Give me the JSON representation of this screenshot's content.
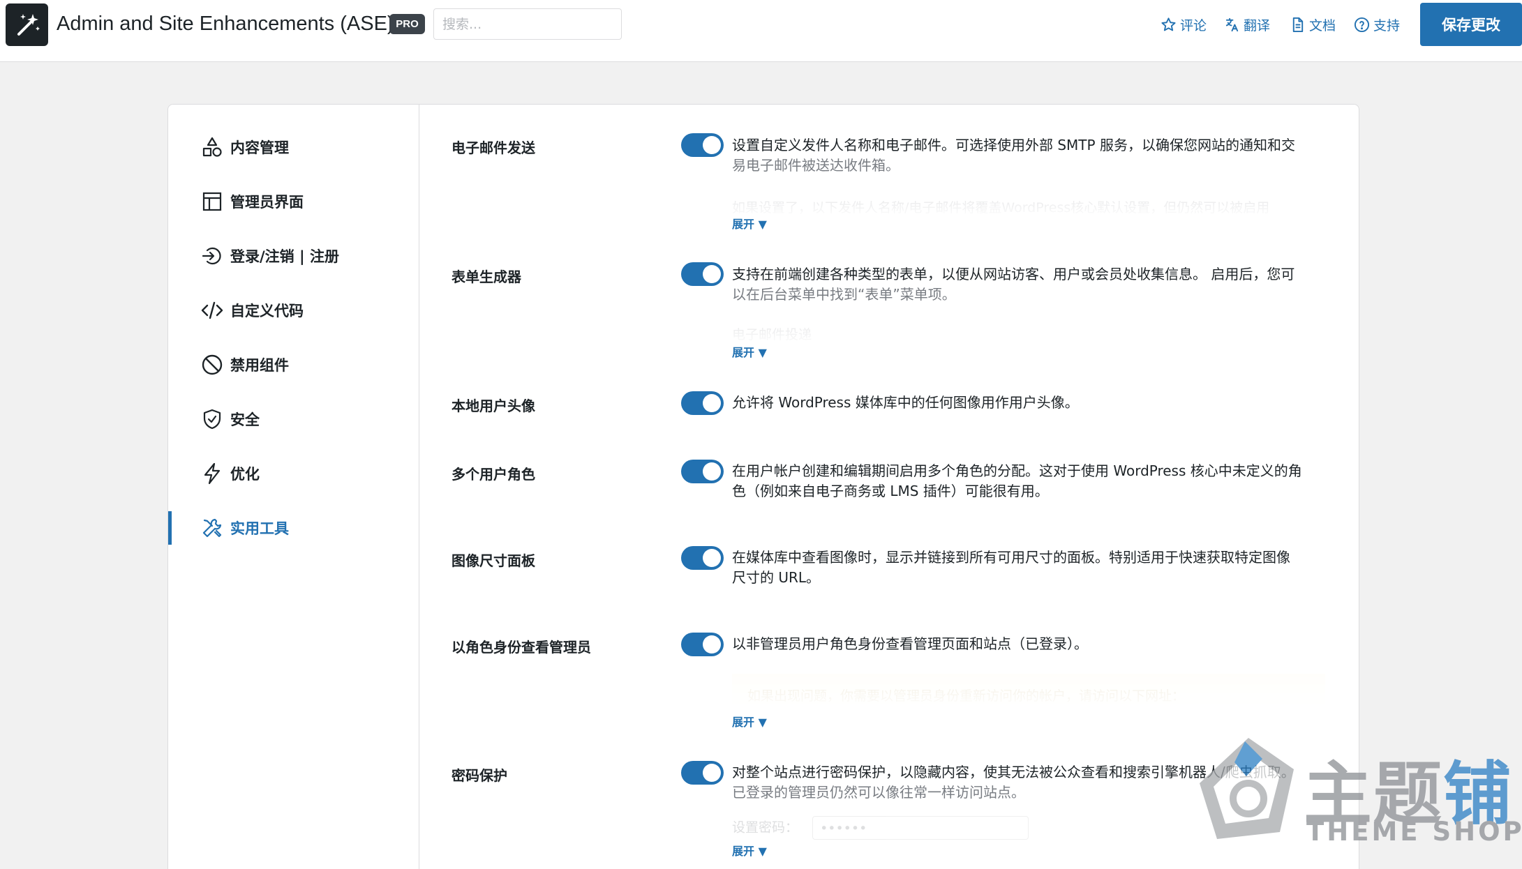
{
  "header": {
    "app_title": "Admin and Site Enhancements (ASE)",
    "pro_badge": "PRO",
    "search_placeholder": "搜索...",
    "links": {
      "review": "评论",
      "translate": "翻译",
      "docs": "文档",
      "support": "支持"
    },
    "save_button": "保存更改"
  },
  "sidebar": {
    "items": [
      {
        "label": "内容管理",
        "icon": "shapes-icon",
        "active": false
      },
      {
        "label": "管理员界面",
        "icon": "layout-icon",
        "active": false
      },
      {
        "label": "登录/注销 | 注册",
        "icon": "login-icon",
        "active": false
      },
      {
        "label": "自定义代码",
        "icon": "code-icon",
        "active": false
      },
      {
        "label": "禁用组件",
        "icon": "ban-icon",
        "active": false
      },
      {
        "label": "安全",
        "icon": "shield-icon",
        "active": false
      },
      {
        "label": "优化",
        "icon": "lightning-icon",
        "active": false
      },
      {
        "label": "实用工具",
        "icon": "tools-icon",
        "active": true
      }
    ]
  },
  "settings": [
    {
      "title": "电子邮件发送",
      "enabled": true,
      "description": "设置自定义发件人名称和电子邮件。可选择使用外部 SMTP 服务，以确保您网站的通知和交",
      "description_sub": "易电子邮件被送达收件箱。",
      "faded_text": "如果设置了，以下发件人名称/电子邮件将覆盖WordPress核心默认设置，但仍然可以被启用",
      "expand": "展开 ▼"
    },
    {
      "title": "表单生成器",
      "enabled": true,
      "description": "支持在前端创建各种类型的表单，以便从网站访客、用户或会员处收集信息。 启用后，您可",
      "description_sub": "以在后台菜单中找到“表单”菜单项。",
      "faded_text": "电子邮件投递",
      "expand": "展开 ▼"
    },
    {
      "title": "本地用户头像",
      "enabled": true,
      "description": "允许将 WordPress 媒体库中的任何图像用作用户头像。"
    },
    {
      "title": "多个用户角色",
      "enabled": true,
      "description": "在用户帐户创建和编辑期间启用多个角色的分配。这对于使用 WordPress 核心中未定义的角",
      "description_line2": "色（例如来自电子商务或 LMS 插件）可能很有用。"
    },
    {
      "title": "图像尺寸面板",
      "enabled": true,
      "description": "在媒体库中查看图像时，显示并链接到所有可用尺寸的面板。特别适用于快速获取特定图像",
      "description_line2": "尺寸的 URL。"
    },
    {
      "title": "以角色身份查看管理员",
      "enabled": true,
      "description": "以非管理员用户角色身份查看管理页面和站点（已登录）。",
      "faded_text": "如果出现问题，你需要以管理员身份重新访问你的帐户，请访问以下网址：",
      "expand": "展开 ▼"
    },
    {
      "title": "密码保护",
      "enabled": true,
      "description": "对整个站点进行密码保护，以隐藏内容，使其无法被公众查看和搜索引擎机器人/爬虫抓取。",
      "description_sub": "已登录的管理员仍然可以像往常一样访问站点。",
      "faded_label": "设置密码：",
      "faded_value": "••••••",
      "expand": "展开 ▼"
    }
  ],
  "watermark": {
    "text_gray": "主题",
    "text_blue": "铺",
    "sub": "THEME SHOP"
  },
  "colors": {
    "accent": "#2271b1",
    "text": "#1d2327",
    "muted": "#787c82",
    "background": "#f1f1f1"
  }
}
